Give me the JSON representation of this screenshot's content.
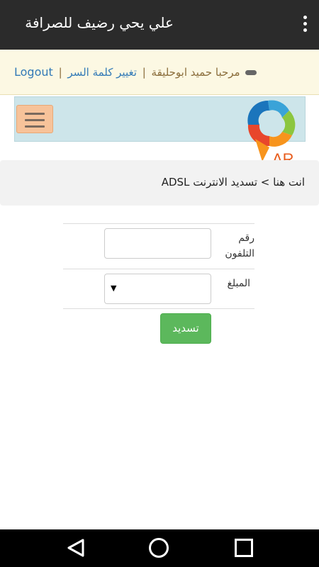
{
  "app": {
    "title": "علي يحي رضيف للصرافة"
  },
  "alert": {
    "logout": "Logout",
    "separator": "|",
    "greeting": "مرحبا حميد ابوحليقة",
    "change_password": "تغيير كلمة السر"
  },
  "logo": {
    "text": "AR"
  },
  "breadcrumb": {
    "text": "انت هنا > تسديد الانترنت ADSL"
  },
  "form": {
    "phone_label": "رقم التلفون",
    "phone_value": "",
    "amount_label": "المبلغ",
    "amount_value": "",
    "dropdown_arrow": "▼",
    "submit_label": "تسديد"
  },
  "colors": {
    "app_bar": "#2b2b2b",
    "alert_bg": "#fcf8e3",
    "link": "#337ab7",
    "submit": "#5cb85c",
    "menu_button": "#f7c39a",
    "navbar": "#cde5ea"
  }
}
